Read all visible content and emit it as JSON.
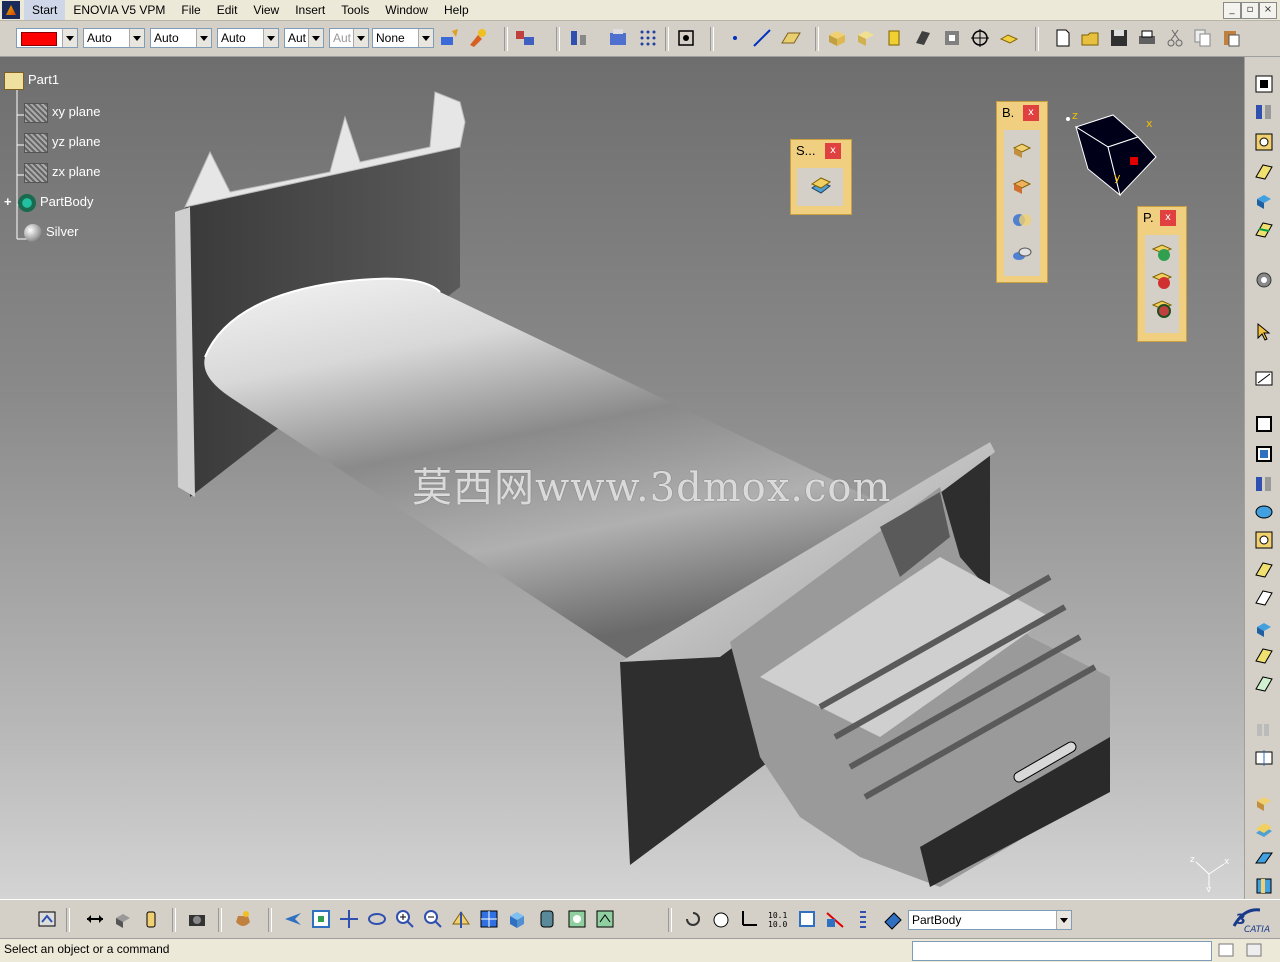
{
  "menubar": {
    "items": [
      "Start",
      "ENOVIA V5 VPM",
      "File",
      "Edit",
      "View",
      "Insert",
      "Tools",
      "Window",
      "Help"
    ]
  },
  "toolbar": {
    "color_swatch": "#ff0000",
    "combo1": "Auto",
    "combo2": "Auto",
    "combo3": "Auto",
    "combo4": "Aut",
    "combo5": "Aut",
    "combo6": "None"
  },
  "tree": {
    "root": "Part1",
    "items": [
      "xy plane",
      "yz plane",
      "zx plane",
      "PartBody",
      "Silver"
    ]
  },
  "watermark": "莫西网www.3dmox.com",
  "floating_toolbars": {
    "s_title": "S...",
    "b_title": "B.",
    "p_title": "P.",
    "close": "x"
  },
  "compass": {
    "x": "x",
    "y": "y",
    "z": "z"
  },
  "bottom": {
    "current_body": "PartBody"
  },
  "status": {
    "text": "Select an object or a command"
  },
  "icons": [
    "select-icon",
    "sketch-icon",
    "pad-icon",
    "pocket-icon",
    "shaft-icon",
    "groove-icon",
    "hole-icon",
    "rib-icon",
    "slot-icon",
    "fillet-icon",
    "chamfer-icon",
    "draft-icon",
    "shell-icon",
    "thickness-icon",
    "thread-icon",
    "fly-icon",
    "fit-all-icon",
    "pan-icon",
    "rotate-icon",
    "zoom-in-icon",
    "zoom-out-icon",
    "normal-view-icon",
    "iso-view-icon",
    "shading-icon",
    "hide-show-icon",
    "swap-icon",
    "update-icon",
    "measure-icon",
    "scan-icon",
    "catia-logo"
  ]
}
